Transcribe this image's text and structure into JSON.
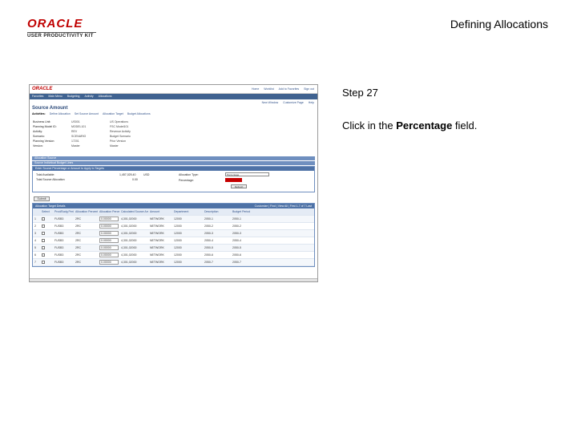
{
  "slide": {
    "logo_line1": "ORACLE",
    "logo_line2": "USER PRODUCTIVITY KIT",
    "title": "Defining Allocations",
    "step": "Step 27",
    "instruction_prefix": "Click in the ",
    "instruction_target": "Percentage",
    "instruction_suffix": " field."
  },
  "app": {
    "logo": "ORACLE",
    "header_links": [
      "Home",
      "Worklist",
      "Add to Favorites",
      "Sign out"
    ],
    "menu": [
      "Favorites",
      "Main Menu",
      "Budgeting",
      "Activity",
      "Allocations"
    ],
    "toolbar": [
      "New Window",
      "Customize Page",
      "Help"
    ],
    "page_heading": "Source Amount",
    "crumbs_label": "Activities:",
    "crumbs": [
      "Define Allocation",
      "Set Source Amount",
      "Allocation Target",
      "Budget Allocations"
    ],
    "fields": [
      {
        "k": "Business Unit:",
        "v": "US001",
        "d": "US Operations"
      },
      {
        "k": "Planning Model ID:",
        "v": "MODEL101",
        "d": "FSC Model101"
      },
      {
        "k": "Activity:",
        "v": "REV",
        "d": "Revenue Activity"
      },
      {
        "k": "Scenario:",
        "v": "SCENARIO",
        "d": "Budget Scenario"
      },
      {
        "k": "Planning Version:",
        "v": "17201",
        "d": "Prior Version"
      },
      {
        "k": "Version:",
        "v": "Master",
        "d": "Master"
      }
    ],
    "bars": [
      "Allocation Source",
      "Source Individual Budget Lines"
    ],
    "alloc_header": "Enter Source Percentage or Amount to Apply to Targets",
    "total_available_label": "Total Available:",
    "total_available_value": "1,457,025.40",
    "total_available_currency": "USD",
    "total_source_label": "Total Source Allocation:",
    "total_source_value": "0.00",
    "allocation_type_label": "Allocation Type:",
    "allocation_type_value": "Percentage",
    "percentage_label": "Percentage:",
    "refresh_label": "Refresh",
    "submit_label": "Submit",
    "grid_title": "Allocation Target Details",
    "grid_nav": "Customize | Find | View All | First  1-7 of 7  Last",
    "columns": [
      "Select",
      "Prod/Budg Period",
      "Allocation Percent",
      "Allocation Percentage",
      "Calculated Source Amount",
      "Amount",
      "Department",
      "Description",
      "Budget Period"
    ],
    "rows": [
      {
        "n": "1",
        "prd": "FUSB3",
        "alc": "2RC",
        "pct": "0.00000",
        "calc": "4,301,02000",
        "amt": "NETWORK",
        "dep": "12000",
        "dsc": "2050-1",
        "bud": "2050-1"
      },
      {
        "n": "2",
        "prd": "FUSB3",
        "alc": "2RC",
        "pct": "0.00000",
        "calc": "4,301,02000",
        "amt": "NETWORK",
        "dep": "12000",
        "dsc": "2050-2",
        "bud": "2050-2"
      },
      {
        "n": "3",
        "prd": "FUSB3",
        "alc": "2RC",
        "pct": "0.00000",
        "calc": "4,301,02000",
        "amt": "NETWORK",
        "dep": "12000",
        "dsc": "2050-3",
        "bud": "2050-3"
      },
      {
        "n": "4",
        "prd": "FUSB3",
        "alc": "2RC",
        "pct": "0.00000",
        "calc": "4,301,02000",
        "amt": "NETWORK",
        "dep": "12000",
        "dsc": "2050-4",
        "bud": "2050-4"
      },
      {
        "n": "5",
        "prd": "FUSB3",
        "alc": "2RC",
        "pct": "0.00000",
        "calc": "4,301,02000",
        "amt": "NETWORK",
        "dep": "12000",
        "dsc": "2050-5",
        "bud": "2050-5"
      },
      {
        "n": "6",
        "prd": "FUSB3",
        "alc": "2RC",
        "pct": "0.00000",
        "calc": "4,301,02000",
        "amt": "NETWORK",
        "dep": "12000",
        "dsc": "2050-6",
        "bud": "2050-6"
      },
      {
        "n": "7",
        "prd": "FUSB3",
        "alc": "2RC",
        "pct": "0.00000",
        "calc": "4,301,02000",
        "amt": "NETWORK",
        "dep": "12000",
        "dsc": "2050-7",
        "bud": "2050-7"
      }
    ]
  }
}
